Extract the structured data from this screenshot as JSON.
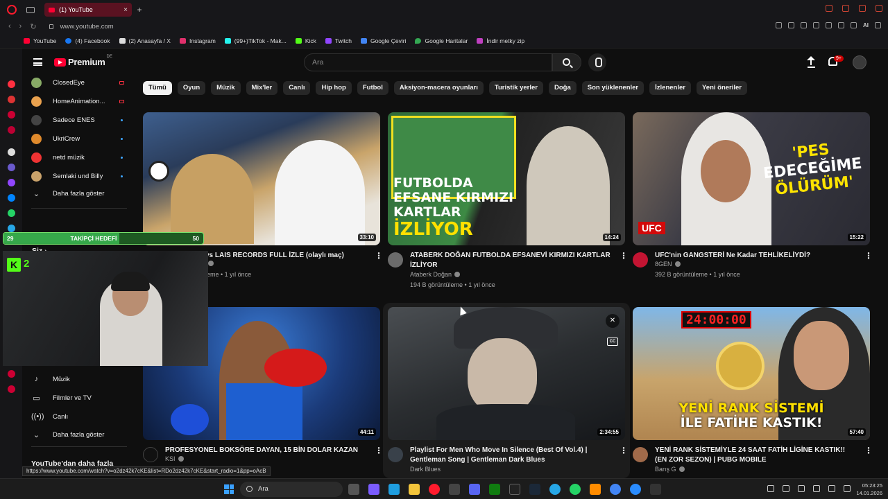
{
  "browser": {
    "tab_title": "(1) YouTube",
    "url": "www.youtube.com",
    "ai_label": "AI",
    "bookmarks": [
      "YouTube",
      "(4) Facebook",
      "(2) Anasayfa / X",
      "Instagram",
      "(99+)TikTok - Mak...",
      "Kick",
      "Twitch",
      "Google Çeviri",
      "Google Haritalar",
      "İndir metky zip"
    ]
  },
  "youtube": {
    "logo_text": "Premium",
    "country": "DE",
    "search_placeholder": "Ara",
    "notif_count": "9+",
    "chips": [
      "Tümü",
      "Oyun",
      "Müzik",
      "Mix'ler",
      "Canlı",
      "Hip hop",
      "Futbol",
      "Aksiyon-macera oyunları",
      "Turistik yerler",
      "Doğa",
      "Son yüklenenler",
      "İzlenenler",
      "Yeni öneriler"
    ],
    "subscriptions": [
      {
        "name": "ClosedEye",
        "state": "live"
      },
      {
        "name": "HomeAnimation...",
        "state": "live"
      },
      {
        "name": "Sadece ENES",
        "state": "new"
      },
      {
        "name": "UkriCrew",
        "state": "new"
      },
      {
        "name": "netd müzik",
        "state": "new"
      },
      {
        "name": "Semlaki und Billy",
        "state": "new"
      }
    ],
    "show_more": "Daha fazla göster",
    "you_section": "Siz",
    "explore": [
      {
        "icon": "music-note-icon",
        "label": "Müzik"
      },
      {
        "icon": "film-icon",
        "label": "Filmler ve TV"
      },
      {
        "icon": "live-icon",
        "label": "Canlı"
      },
      {
        "icon": "chevron-down-icon",
        "label": "Daha fazla göster"
      }
    ],
    "more_from": "YouTube'dan daha fazla",
    "videos": [
      {
        "title": "vs LAIS RECORDS FULL İZLE (olaylı maç)",
        "channel": "",
        "stats": "leme • 1 yıl önce",
        "duration": "33:10"
      },
      {
        "title": "ATABERK DOĞAN FUTBOLDA EFSANEVİ KIRMIZI KARTLAR İZLİYOR",
        "channel": "Ataberk Doğan",
        "stats": "194 B görüntüleme • 1 yıl önce",
        "duration": "14:24",
        "thumb_text": [
          "FUTBOLDA",
          "EFSANE KIRMIZI",
          "KARTLAR",
          "İZLİYOR"
        ]
      },
      {
        "title": "UFC'nin GANGSTERİ Ne Kadar TEHLİKELİYDİ?",
        "channel": "8GEN",
        "stats": "392 B görüntüleme • 1 yıl önce",
        "duration": "15:22",
        "thumb_text": [
          "'PES",
          "EDECEĞİME",
          "ÖLÜRÜM'"
        ],
        "thumb_badge": "UFC"
      },
      {
        "title": "PROFESYONEL BOKSÖRE DAYAN, 15 BİN DOLAR KAZAN",
        "channel": "KSI",
        "stats": "",
        "duration": "44:11"
      },
      {
        "title": "Playlist For Men Who Move In Silence (Best Of Vol.4) | Gentleman Song | Gentleman Dark Blues",
        "channel": "Dark Blues",
        "stats": "",
        "duration": "2:34:55"
      },
      {
        "title": "YENİ RANK SİSTEMİYLE 24 SAAT FATİH LİGİNE KASTIK!! (EN ZOR SEZON) | PUBG MOBILE",
        "channel": "Barış G",
        "stats": "",
        "duration": "57:40",
        "thumb_text": [
          "YENİ RANK SİSTEMİ",
          "İLE FATİHE KASTIK!"
        ],
        "thumb_timer": "24:00:00"
      }
    ],
    "status_link": "https://www.youtube.com/watch?v=o2dz42k7cKE&list=RDo2dz42k7cKE&start_radio=1&pp=oAcB"
  },
  "stream_overlay": {
    "follower_current": "29",
    "follower_label": "TAKİPÇİ HEDEFİ",
    "follower_goal": "50",
    "follower_progress": 0.58,
    "kick_logo": "K",
    "kick_number": "2"
  },
  "taskbar": {
    "search_label": "Ara",
    "time": "05:23:25",
    "date": "14.01.2026"
  }
}
